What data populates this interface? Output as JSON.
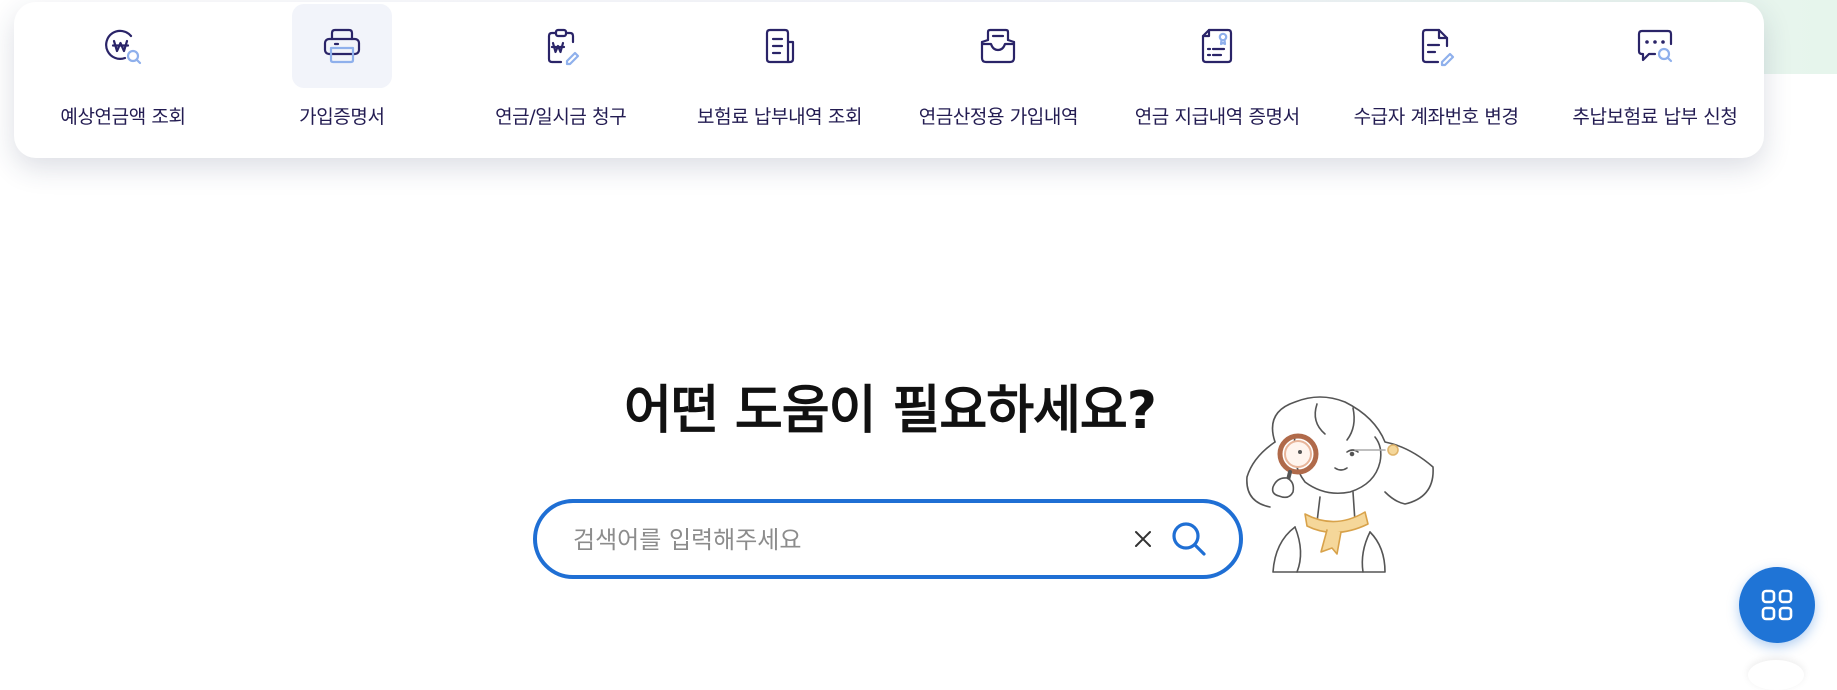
{
  "quick_menu": {
    "items": [
      {
        "label": "예상연금액 조회",
        "icon": "won-search-icon"
      },
      {
        "label": "가입증명서",
        "icon": "printer-icon"
      },
      {
        "label": "연금/일시금 청구",
        "icon": "clipboard-won-icon"
      },
      {
        "label": "보험료 납부내역 조회",
        "icon": "receipt-icon"
      },
      {
        "label": "연금산정용 가입내역",
        "icon": "inbox-icon"
      },
      {
        "label": "연금 지급내역 증명서",
        "icon": "certificate-icon"
      },
      {
        "label": "수급자 계좌번호 변경",
        "icon": "document-edit-icon"
      },
      {
        "label": "추납보험료 납부 신청",
        "icon": "chat-search-icon"
      }
    ],
    "active_index": 1
  },
  "hero": {
    "title": "어떤 도움이 필요하세요?"
  },
  "search": {
    "placeholder": "검색어를 입력해주세요",
    "value": ""
  },
  "colors": {
    "accent": "#1f74d6",
    "icon": "#2a2468",
    "icon_accent": "#8fb0ec",
    "label": "#231c52"
  }
}
